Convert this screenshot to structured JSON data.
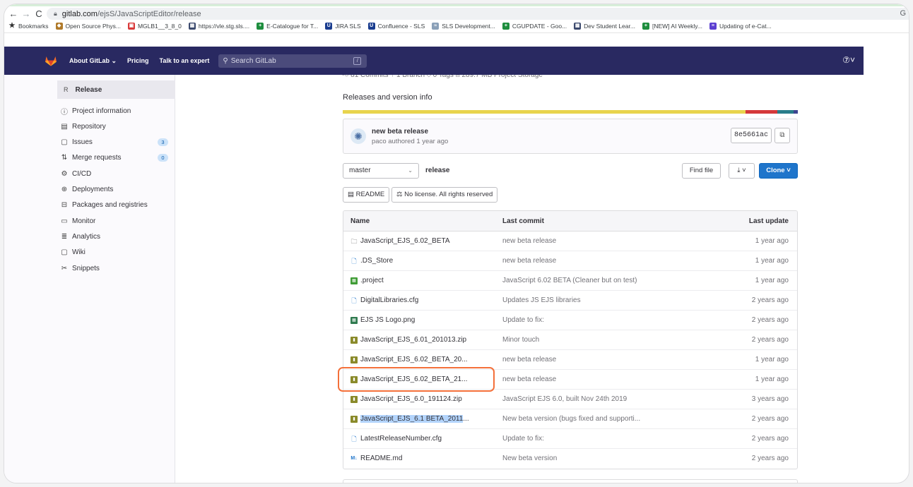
{
  "browser": {
    "url_host": "gitlab.com",
    "url_path": "/ejsS/JavaScriptEditor/release",
    "right_letter": "G",
    "bookmarks": [
      {
        "label": "Bookmarks",
        "color": "#333333",
        "glyph": "★"
      },
      {
        "label": "Open Source Phys...",
        "color": "#b07a2a",
        "glyph": "◆"
      },
      {
        "label": "MGLB1__3_8_0",
        "color": "#d93a3a",
        "glyph": "▣"
      },
      {
        "label": "https://vle.stg.sls....",
        "color": "#3c4a6e",
        "glyph": "▦"
      },
      {
        "label": "E-Catalogue for T...",
        "color": "#1e8e3e",
        "glyph": "+"
      },
      {
        "label": "JIRA SLS",
        "color": "#1a3d8f",
        "glyph": "U"
      },
      {
        "label": "Confluence - SLS",
        "color": "#1a3d8f",
        "glyph": "U"
      },
      {
        "label": "SLS Development...",
        "color": "#8aa0b8",
        "glyph": "≈"
      },
      {
        "label": "CGUPDATE - Goo...",
        "color": "#1e8e3e",
        "glyph": "+"
      },
      {
        "label": "Dev Student Lear...",
        "color": "#3c4a6e",
        "glyph": "▦"
      },
      {
        "label": "[NEW] AI Weekly...",
        "color": "#1e8e3e",
        "glyph": "+"
      },
      {
        "label": "Updating of e-Cat...",
        "color": "#5b3fd1",
        "glyph": "≡"
      }
    ]
  },
  "header": {
    "about": "About GitLab ⌄",
    "pricing": "Pricing",
    "talk": "Talk to an expert",
    "search_placeholder": "Search GitLab",
    "search_key": "/",
    "help": "⑦˅"
  },
  "sidebar": {
    "project_avatar": "R",
    "project_name": "Release",
    "items": [
      {
        "label": "Project information",
        "icon": "info-icon",
        "glyph": "ⓘ"
      },
      {
        "label": "Repository",
        "icon": "repository-icon",
        "glyph": "▤"
      },
      {
        "label": "Issues",
        "icon": "issues-icon",
        "glyph": "▢",
        "badge": "3"
      },
      {
        "label": "Merge requests",
        "icon": "merge-request-icon",
        "glyph": "⇅",
        "badge": "0"
      },
      {
        "label": "CI/CD",
        "icon": "rocket-icon",
        "glyph": "⚙"
      },
      {
        "label": "Deployments",
        "icon": "deployments-icon",
        "glyph": "⊕"
      },
      {
        "label": "Packages and registries",
        "icon": "package-icon",
        "glyph": "⊟"
      },
      {
        "label": "Monitor",
        "icon": "monitor-icon",
        "glyph": "▭"
      },
      {
        "label": "Analytics",
        "icon": "analytics-icon",
        "glyph": "≣"
      },
      {
        "label": "Wiki",
        "icon": "wiki-icon",
        "glyph": "▢"
      },
      {
        "label": "Snippets",
        "icon": "snippets-icon",
        "glyph": "✂"
      }
    ]
  },
  "project": {
    "description": "Releases and version info",
    "stats_partial": "-○ 81 Commits   ⑂ 1 Branch   ◇ 0 Tags   ▭ 289.7 MB Project Storage",
    "language_colors": [
      "#e8d44d",
      "#e8d44d",
      "#d5393a",
      "#2a7d8a",
      "#3e4691"
    ]
  },
  "last_commit": {
    "title": "new beta release",
    "meta": "paco authored 1 year ago",
    "sha": "8e5661ac",
    "copy_icon": "⧉"
  },
  "controls": {
    "branch": "master",
    "path": "release",
    "find_file": "Find file",
    "download": "⤓ ˅",
    "clone": "Clone ˅",
    "readme": "▤ README",
    "license": "⚖ No license. All rights reserved"
  },
  "table": {
    "headers": {
      "name": "Name",
      "commit": "Last commit",
      "update": "Last update"
    },
    "rows": [
      {
        "name": "JavaScript_EJS_6.02_BETA",
        "icon": "folder",
        "commit": "new beta release",
        "date": "1 year ago"
      },
      {
        "name": ".DS_Store",
        "icon": "doc",
        "commit": "new beta release",
        "date": "1 year ago"
      },
      {
        "name": ".project",
        "icon": "green",
        "commit": "JavaScript 6.02 BETA (Cleaner but on test)",
        "date": "1 year ago"
      },
      {
        "name": "DigitalLibraries.cfg",
        "icon": "doc",
        "commit": "Updates JS EJS libraries",
        "date": "2 years ago"
      },
      {
        "name": "EJS JS Logo.png",
        "icon": "img",
        "commit": "Update to fix:",
        "date": "2 years ago"
      },
      {
        "name": "JavaScript_EJS_6.01_201013.zip",
        "icon": "zip",
        "commit": "Minor touch",
        "date": "2 years ago"
      },
      {
        "name": "JavaScript_EJS_6.02_BETA_20...",
        "icon": "zip",
        "commit": "new beta release",
        "date": "1 year ago"
      },
      {
        "name": "JavaScript_EJS_6.02_BETA_21...",
        "icon": "zip",
        "commit": "new beta release",
        "date": "1 year ago"
      },
      {
        "name": "JavaScript_EJS_6.0_191124.zip",
        "icon": "zip",
        "commit": "JavaScript EJS 6.0, built Nov 24th 2019",
        "date": "3 years ago"
      },
      {
        "name": "JavaScript_EJS_6.1 BETA_2011...",
        "icon": "zip",
        "commit": "New beta version (bugs fixed and supporti...",
        "date": "2 years ago",
        "selected": "JavaScript_EJS_6.1 BETA_2011",
        "rest": "..."
      },
      {
        "name": "LatestReleaseNumber.cfg",
        "icon": "doc",
        "commit": "Update to fix:",
        "date": "2 years ago"
      },
      {
        "name": "README.md",
        "icon": "md",
        "commit": "New beta version",
        "date": "2 years ago"
      }
    ]
  },
  "colors": {
    "header_bg": "#292961",
    "primary": "#1f75cb",
    "highlight": "#f4703a"
  }
}
